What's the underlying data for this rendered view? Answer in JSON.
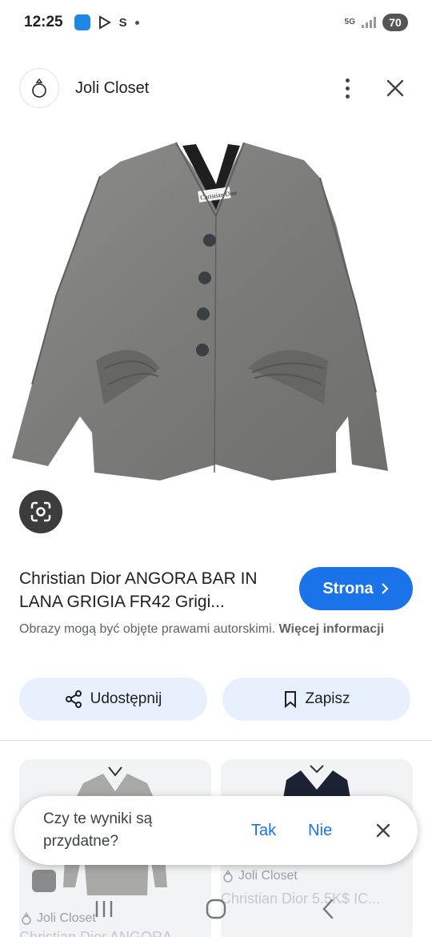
{
  "status_bar": {
    "time": "12:25",
    "glyph": "S",
    "network": "5G",
    "battery": "70"
  },
  "header": {
    "site_name": "Joli Closet",
    "logo_icon": "ring-icon",
    "more_icon": "more-vert-icon",
    "close_icon": "close-icon"
  },
  "image": {
    "description_icon": "jacket-image",
    "label_text": "Christian Dior"
  },
  "result": {
    "title": "Christian Dior ANGORA BAR IN LANA GRIGIA FR42 Grigi...",
    "visit_label": "Strona",
    "copyright_text": "Obrazy mogą być objęte prawami autorskimi.",
    "copyright_link": "Więcej informacji"
  },
  "actions": {
    "share_label": "Udostępnij",
    "save_label": "Zapisz"
  },
  "related": [
    {
      "source": "Joli Closet",
      "title": "Christian Dior ANGORA"
    },
    {
      "source": "Joli Closet",
      "title": "Christian Dior 5.5K$ IC..."
    }
  ],
  "feedback": {
    "question": "Czy te wyniki są przydatne?",
    "yes": "Tak",
    "no": "Nie"
  },
  "colors": {
    "accent": "#1a73e8",
    "chip_bg": "#e8f0fe",
    "lens_bg": "#3c3c3c"
  }
}
